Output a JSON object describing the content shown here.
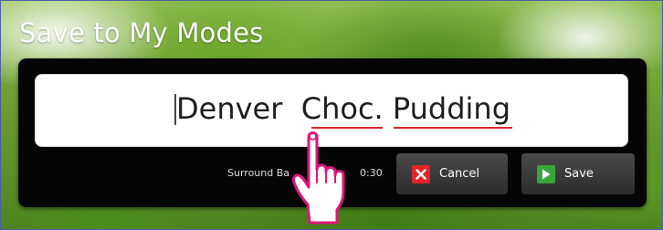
{
  "dialog": {
    "title": "Save to My Modes",
    "name_value": "Denver  Choc. Pudding",
    "info_label": "Surround Ba",
    "time_value": "0:30"
  },
  "buttons": {
    "cancel_label": "Cancel",
    "save_label": "Save"
  },
  "icons": {
    "cancel": "close-x-icon",
    "save": "play-icon",
    "overlay": "pointing-hand-icon"
  },
  "colors": {
    "panel": "#050505",
    "cancel_icon": "#e2232a",
    "save_icon": "#3aa53a",
    "spellcheck_underline": "#d9242b",
    "hand_outline": "#e0157a"
  }
}
